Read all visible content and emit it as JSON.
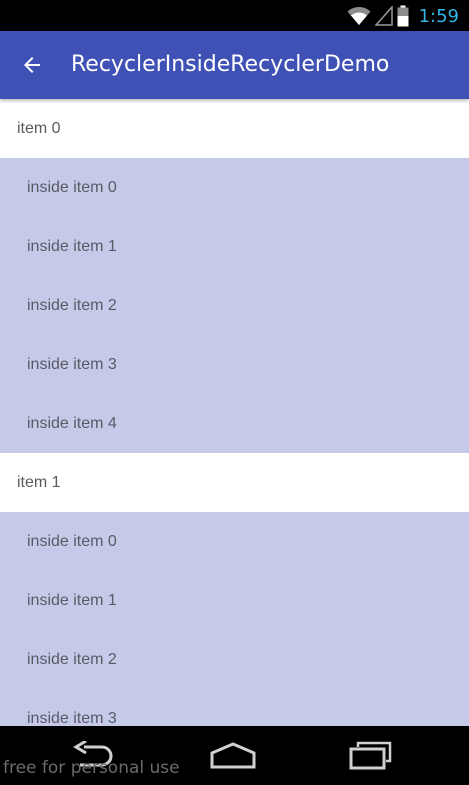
{
  "status_bar": {
    "time": "1:59",
    "icons": [
      "wifi-icon",
      "signal-icon",
      "battery-icon"
    ]
  },
  "app_bar": {
    "title": "RecyclerInsideRecyclerDemo",
    "back_icon": "arrow-back-icon",
    "background": "#3f51b5"
  },
  "list": {
    "groups": [
      {
        "label": "item  0",
        "children": [
          "inside item  0",
          "inside item  1",
          "inside item  2",
          "inside item  3",
          "inside item  4"
        ]
      },
      {
        "label": "item  1",
        "children": [
          "inside item  0",
          "inside item  1",
          "inside item  2",
          "inside item  3"
        ]
      }
    ],
    "inner_background": "#c5cae9"
  },
  "nav_bar": {
    "buttons": [
      "back-icon",
      "home-icon",
      "recents-icon"
    ]
  },
  "watermark": "free for personal use"
}
